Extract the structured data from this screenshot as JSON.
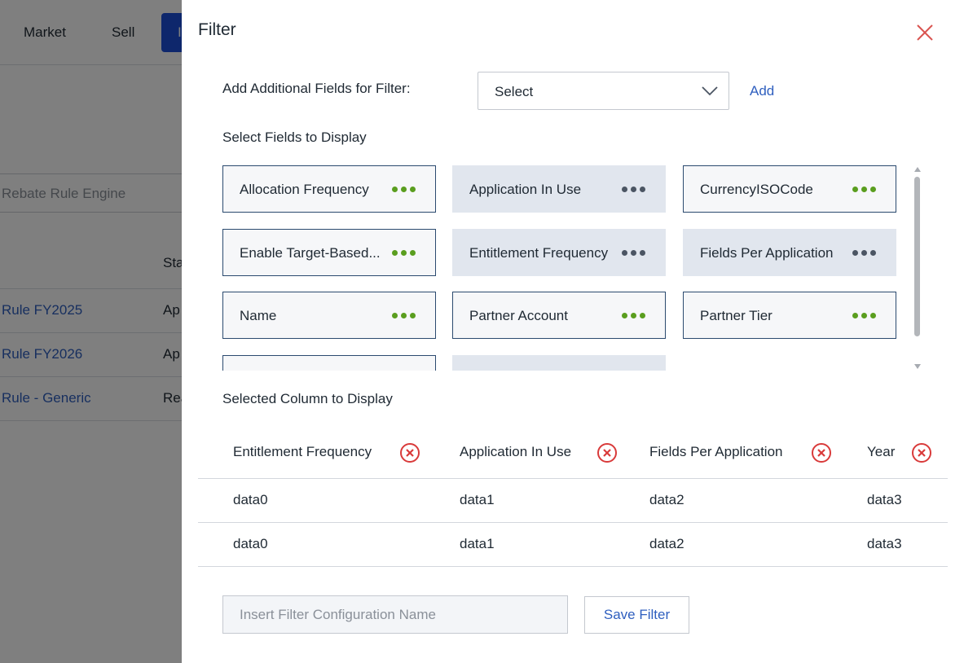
{
  "background": {
    "nav": {
      "items": [
        "Market",
        "Sell",
        "I"
      ]
    },
    "search_text": "Rebate Rule Engine",
    "table_header_partial": "Sta",
    "rows": [
      {
        "name": "Rule FY2025",
        "status": "Ap"
      },
      {
        "name": "Rule FY2026",
        "status": "Ap"
      },
      {
        "name": "Rule - Generic",
        "status": "Rea"
      }
    ]
  },
  "panel": {
    "title": "Filter",
    "add_fields": {
      "label": "Add Additional Fields for Filter:",
      "select_value": "Select",
      "add_label": "Add"
    },
    "fields_section_label": "Select Fields to Display",
    "fields": [
      {
        "label": "Allocation Frequency",
        "selected": false
      },
      {
        "label": "Application In Use",
        "selected": true
      },
      {
        "label": "CurrencyISOCode",
        "selected": false
      },
      {
        "label": "Enable Target-Based...",
        "selected": false
      },
      {
        "label": "Entitlement Frequency",
        "selected": true
      },
      {
        "label": "Fields Per Application",
        "selected": true
      },
      {
        "label": "Name",
        "selected": false
      },
      {
        "label": "Partner Account",
        "selected": false
      },
      {
        "label": "Partner Tier",
        "selected": false
      },
      {
        "label": "",
        "selected": false
      },
      {
        "label": "",
        "selected": true
      }
    ],
    "selected_section_label": "Selected Column to Display",
    "selected_columns": [
      "Entitlement Frequency",
      "Application In Use",
      "Fields Per Application",
      "Year"
    ],
    "rows": [
      [
        "data0",
        "data1",
        "data2",
        "data3"
      ],
      [
        "data0",
        "data1",
        "data2",
        "data3"
      ]
    ],
    "config_placeholder": "Insert Filter Configuration Name",
    "save_label": "Save Filter"
  },
  "colors": {
    "accent": "#2f5fbf",
    "dots_green": "#5a9e1f",
    "dots_gray": "#4b5563",
    "remove_red": "#d93a3a",
    "close_red": "#d9534f"
  },
  "icons": {
    "close": "close-icon",
    "dropdown": "chevron-down-icon",
    "remove": "remove-circle-icon",
    "more": "more-dots-icon"
  }
}
